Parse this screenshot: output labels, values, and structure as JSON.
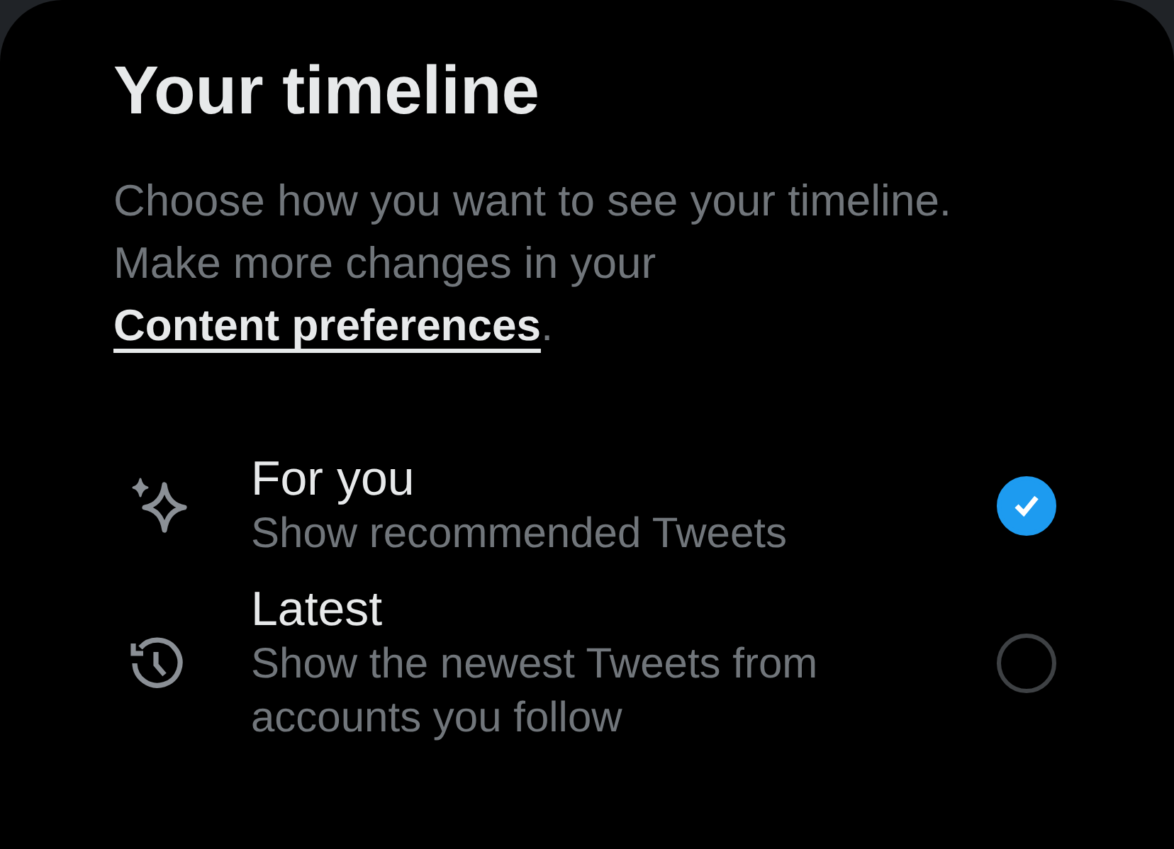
{
  "title": "Your timeline",
  "description": {
    "text": "Choose how you want to see your timeline. Make more changes in your ",
    "link": "Content preferences",
    "end": "."
  },
  "options": [
    {
      "kind": "sparkle",
      "label": "For you",
      "subtitle": "Show recommended Tweets",
      "selected": true
    },
    {
      "kind": "history",
      "label": "Latest",
      "subtitle": "Show the newest Tweets from accounts you follow",
      "selected": false
    }
  ]
}
